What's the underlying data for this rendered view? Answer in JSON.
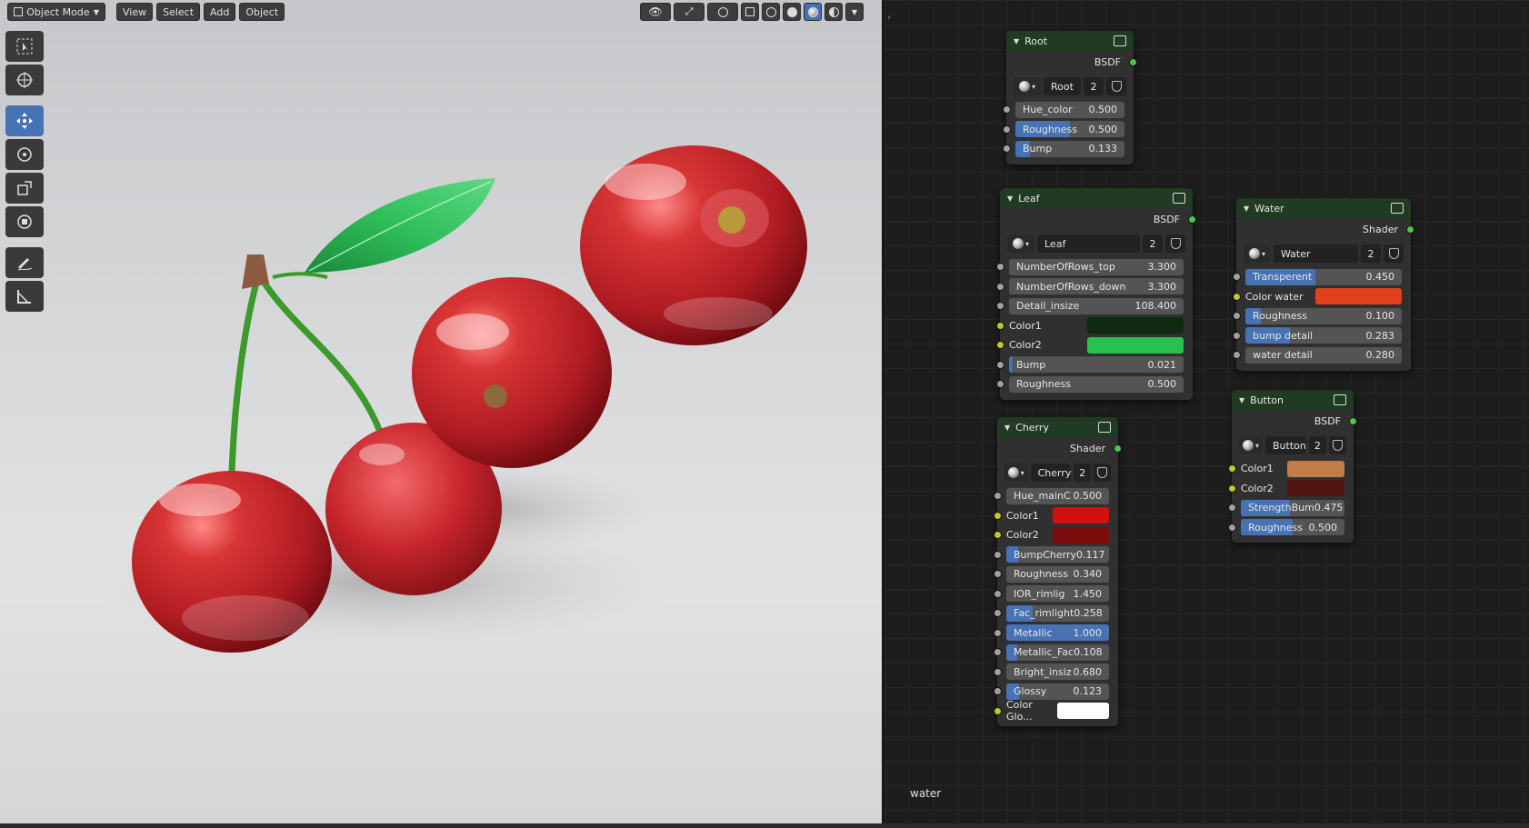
{
  "viewport": {
    "header": {
      "mode_label": "Object Mode",
      "menus": [
        "View",
        "Select",
        "Add",
        "Object"
      ]
    },
    "toolbar": [
      {
        "name": "select-box-tool",
        "active": false
      },
      {
        "name": "cursor-tool",
        "active": false
      },
      {
        "name": "move-tool",
        "active": true
      },
      {
        "name": "rotate-tool",
        "active": false
      },
      {
        "name": "scale-tool",
        "active": false
      },
      {
        "name": "transform-tool",
        "active": false
      },
      {
        "name": "annotate-tool",
        "active": false
      },
      {
        "name": "measure-tool",
        "active": false
      }
    ],
    "shading": {
      "active_mode": "material-preview"
    }
  },
  "node_editor": {
    "frame_label": "water",
    "nodes": {
      "root": {
        "title": "Root",
        "output": "BSDF",
        "group": "Root",
        "users": "2",
        "inputs": [
          {
            "label": "Hue_color",
            "value": "0.500",
            "fill": 0
          },
          {
            "label": "Roughness",
            "value": "0.500",
            "fill": 0.5
          },
          {
            "label": "Bump",
            "value": "0.133",
            "fill": 0.133
          }
        ]
      },
      "leaf": {
        "title": "Leaf",
        "output": "BSDF",
        "group": "Leaf",
        "users": "2",
        "inputs": [
          {
            "label": "NumberOfRows_top",
            "value": "3.300",
            "fill": 0
          },
          {
            "label": "NumberOfRows_down",
            "value": "3.300",
            "fill": 0
          },
          {
            "label": "Detail_insize",
            "value": "108.400",
            "fill": 0
          },
          {
            "label": "Color1",
            "color": "#0f2a10"
          },
          {
            "label": "Color2",
            "color": "#28c150"
          },
          {
            "label": "Bump",
            "value": "0.021",
            "fill": 0.021
          },
          {
            "label": "Roughness",
            "value": "0.500",
            "fill": 0
          }
        ]
      },
      "water": {
        "title": "Water",
        "output": "Shader",
        "group": "Water",
        "users": "2",
        "inputs": [
          {
            "label": "Transperent",
            "value": "0.450",
            "fill": 0.45
          },
          {
            "label": "Color water",
            "color": "#e0401c"
          },
          {
            "label": "Roughness",
            "value": "0.100",
            "fill": 0.1
          },
          {
            "label": "bump detail",
            "value": "0.283",
            "fill": 0.283
          },
          {
            "label": "water detail",
            "value": "0.280",
            "fill": 0
          }
        ]
      },
      "button": {
        "title": "Button",
        "output": "BSDF",
        "group": "Button",
        "users": "2",
        "inputs": [
          {
            "label": "Color1",
            "color": "#c27c4a"
          },
          {
            "label": "Color2",
            "color": "#4d1410"
          },
          {
            "label": "StrengthBum",
            "value": "0.475",
            "fill": 0.475
          },
          {
            "label": "Roughness",
            "value": "0.500",
            "fill": 0.5
          }
        ]
      },
      "cherry": {
        "title": "Cherry",
        "output": "Shader",
        "group": "Cherry",
        "users": "2",
        "inputs": [
          {
            "label": "Hue_mainC",
            "value": "0.500",
            "fill": 0
          },
          {
            "label": "Color1",
            "color": "#d40d0d"
          },
          {
            "label": "Color2",
            "color": "#7c0c0c"
          },
          {
            "label": "BumpCherry",
            "value": "0.117",
            "fill": 0.117
          },
          {
            "label": "Roughness",
            "value": "0.340",
            "fill": 0
          },
          {
            "label": "IOR_rimlig",
            "value": "1.450",
            "fill": 0
          },
          {
            "label": "Fac_rimlight",
            "value": "0.258",
            "fill": 0.258
          },
          {
            "label": "Metallic",
            "value": "1.000",
            "fill": 1.0
          },
          {
            "label": "Metallic_Fac",
            "value": "0.108",
            "fill": 0.108
          },
          {
            "label": "Bright_insiz",
            "value": "0.680",
            "fill": 0
          },
          {
            "label": "Glossy",
            "value": "0.123",
            "fill": 0.123
          },
          {
            "label": "Color Glo...",
            "color": "#ffffff"
          }
        ]
      }
    }
  }
}
